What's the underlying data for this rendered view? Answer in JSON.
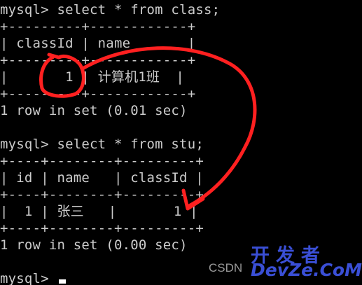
{
  "terminal": {
    "lines": [
      "mysql> select * from class;",
      "+---------+------------+",
      "| classId | name       |",
      "+---------+------------+",
      "|       1 | 计算机1班  |",
      "+---------+------------+",
      "1 row in set (0.01 sec)",
      "",
      "mysql> select * from stu;",
      "+----+--------+---------+",
      "| id | name   | classId |",
      "+----+--------+---------+",
      "|  1 | 张三   |       1 |",
      "+----+--------+---------+",
      "1 row in set (0.00 sec)",
      "",
      "mysql> "
    ]
  },
  "watermark": {
    "csdn": "CSDN",
    "cn": "开发者",
    "en": "DevZe.CoM"
  },
  "colors": {
    "background": "#000000",
    "text": "#cccccc",
    "annotation": "#ff2020",
    "watermark": "#3a4fd6"
  }
}
